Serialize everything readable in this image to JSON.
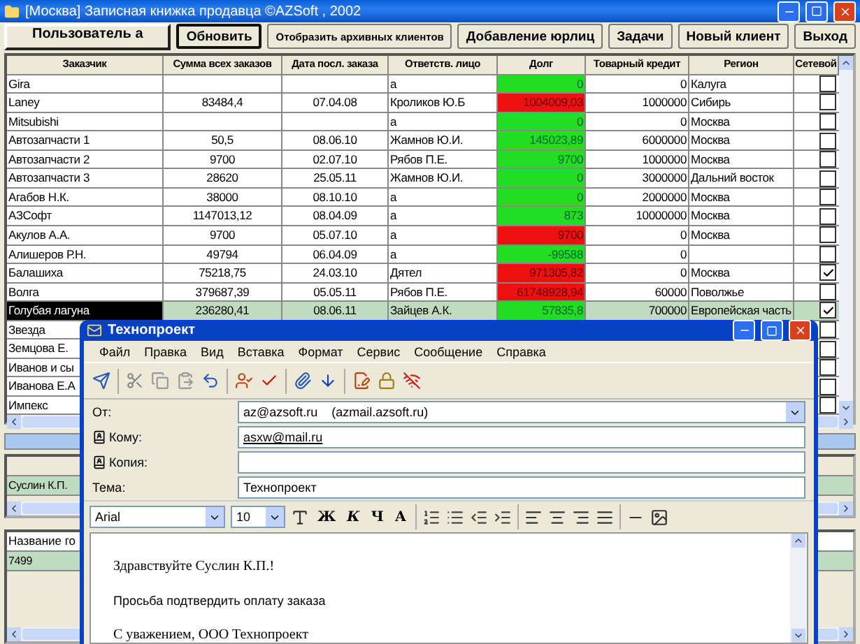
{
  "window": {
    "title": "[Москва] Записная книжка продавца ©AZSoft , 2002"
  },
  "toolbar": {
    "user": "Пользователь а",
    "buttons": [
      "Обновить",
      "Отобразить архивных клиентов",
      "Добавление юрлиц",
      "Задачи",
      "Новый клиент",
      "Выход"
    ]
  },
  "table": {
    "columns": [
      "Заказчик",
      "Сумма всех заказов",
      "Дата посл. заказа",
      "Ответств. лицо",
      "Долг",
      "Товарный кредит",
      "Регион",
      "Сетевой"
    ],
    "rows": [
      {
        "name": "Gira",
        "total": "",
        "last_order": "",
        "manager": "а",
        "debt": "0",
        "overdue": false,
        "credit": "0",
        "region": "Калуга",
        "network": false,
        "selected": false
      },
      {
        "name": "Laney",
        "total": "83484,4",
        "last_order": "07.04.08",
        "manager": "Кроликов Ю.Б",
        "debt": "1004009,03",
        "overdue": true,
        "credit": "1000000",
        "region": "Сибирь",
        "network": false,
        "selected": false
      },
      {
        "name": "Mitsubishi",
        "total": "",
        "last_order": "",
        "manager": "а",
        "debt": "0",
        "overdue": false,
        "credit": "0",
        "region": "Москва",
        "network": false,
        "selected": false
      },
      {
        "name": "Автозапчасти 1",
        "total": "50,5",
        "last_order": "08.06.10",
        "manager": "Жамнов Ю.И.",
        "debt": "145023,89",
        "overdue": false,
        "credit": "6000000",
        "region": "Москва",
        "network": false,
        "selected": false
      },
      {
        "name": "Автозапчасти 2",
        "total": "9700",
        "last_order": "02.07.10",
        "manager": "Рябов П.Е.",
        "debt": "9700",
        "overdue": false,
        "credit": "1000000",
        "region": "Москва",
        "network": false,
        "selected": false
      },
      {
        "name": "Автозапчасти 3",
        "total": "28620",
        "last_order": "25.05.11",
        "manager": "Жамнов Ю.И.",
        "debt": "0",
        "overdue": false,
        "credit": "3000000",
        "region": "Дальний восток",
        "network": false,
        "selected": false
      },
      {
        "name": "Агабов Н.К.",
        "total": "38000",
        "last_order": "08.10.10",
        "manager": "а",
        "debt": "0",
        "overdue": false,
        "credit": "2000000",
        "region": "Москва",
        "network": false,
        "selected": false
      },
      {
        "name": "АЗСофт",
        "total": "1147013,12",
        "last_order": "08.04.09",
        "manager": "а",
        "debt": "873",
        "overdue": false,
        "credit": "10000000",
        "region": "Москва",
        "network": false,
        "selected": false
      },
      {
        "name": "Акулов А.А.",
        "total": "9700",
        "last_order": "05.07.10",
        "manager": "а",
        "debt": "9700",
        "overdue": true,
        "credit": "0",
        "region": "Москва",
        "network": false,
        "selected": false
      },
      {
        "name": "Алишеров Р.Н.",
        "total": "49794",
        "last_order": "06.04.09",
        "manager": "а",
        "debt": "-99588",
        "overdue": false,
        "credit": "0",
        "region": "",
        "network": false,
        "selected": false
      },
      {
        "name": "Балашиха",
        "total": "75218,75",
        "last_order": "24.03.10",
        "manager": "Дятел",
        "debt": "971305,82",
        "overdue": true,
        "credit": "0",
        "region": "Москва",
        "network": true,
        "selected": false
      },
      {
        "name": "Волга",
        "total": "379687,39",
        "last_order": "05.05.11",
        "manager": "Рябов П.Е.",
        "debt": "61748928,94",
        "overdue": true,
        "credit": "60000",
        "region": "Поволжье",
        "network": false,
        "selected": false
      },
      {
        "name": "Голубая лагуна",
        "total": "236280,41",
        "last_order": "08.06.11",
        "manager": "Зайцев А.К.",
        "debt": "57835,8",
        "overdue": false,
        "credit": "700000",
        "region": "Европейская часть",
        "network": true,
        "selected": true
      },
      {
        "name": "Звезда",
        "network": false,
        "selected": false
      },
      {
        "name": "Земцова Е.",
        "network": false,
        "selected": false
      },
      {
        "name": "Иванов и сы",
        "network": false,
        "selected": false
      },
      {
        "name": "Иванова Е.А",
        "network": false,
        "selected": false
      },
      {
        "name": "Импекс",
        "network": false,
        "selected": false
      }
    ]
  },
  "contacts_panel": {
    "rows": [
      {
        "name": "Суслин К.П.",
        "selected": true
      }
    ]
  },
  "goods_panel": {
    "columns": [
      "Название го"
    ],
    "rows": [
      {
        "value": "7499",
        "selected": true
      }
    ]
  },
  "email_window": {
    "title": "Технопроект",
    "menu": [
      "Файл",
      "Правка",
      "Вид",
      "Вставка",
      "Формат",
      "Сервис",
      "Сообщение",
      "Справка"
    ],
    "from": {
      "label": "От:",
      "value": "az@azsoft.ru    (azmail.azsoft.ru)"
    },
    "to": {
      "label": "Кому:",
      "value": "asxw@mail.ru"
    },
    "cc": {
      "label": "Копия:"
    },
    "subject": {
      "label": "Тема:",
      "value": "Технопроект"
    },
    "font": "Arial",
    "size": "10",
    "format_buttons": [
      "Ж",
      "К",
      "Ч",
      "А"
    ],
    "body": [
      {
        "text": "Здравствуйте Суслин К.П.!",
        "kind": "serif"
      },
      {
        "text": "Просьба подтвердить оплату заказа",
        "kind": "sans"
      },
      {
        "text": "С уважением, ООО Технопроект",
        "kind": "serif"
      }
    ]
  }
}
